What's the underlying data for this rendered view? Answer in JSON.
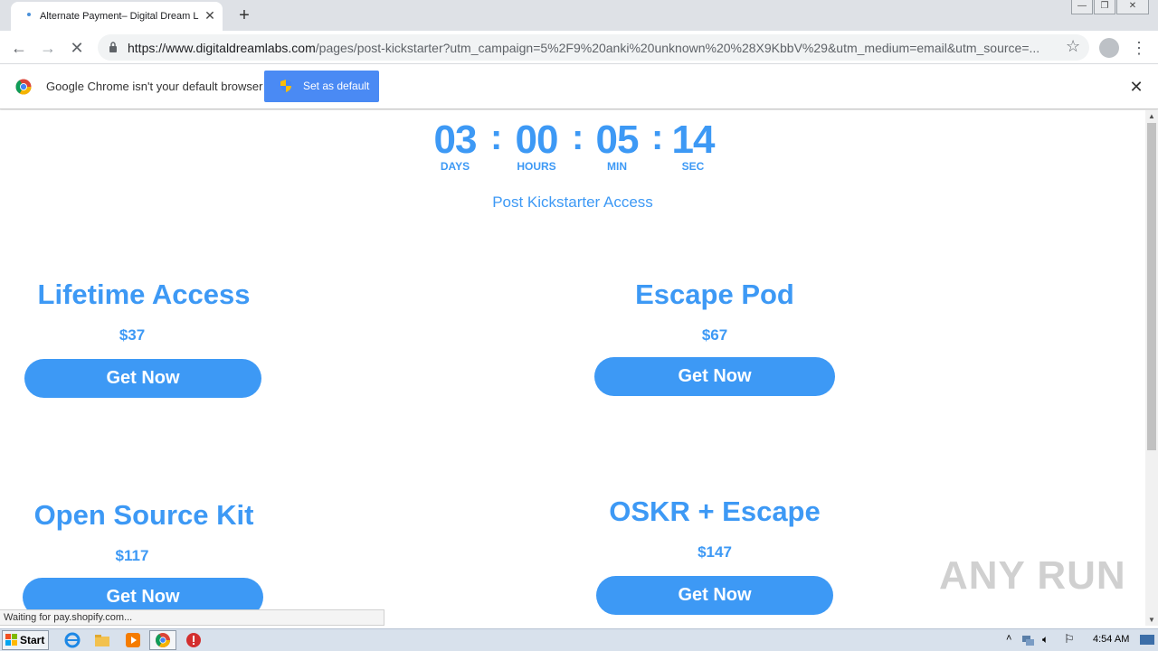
{
  "browser": {
    "tab_title": "Alternate Payment– Digital Dream La",
    "tab_close": "✕",
    "new_tab": "+",
    "window_controls": [
      "—",
      "❐",
      "✕"
    ],
    "url_host": "https://www.digitaldreamlabs.com",
    "url_rest": "/pages/post-kickstarter?utm_campaign=5%2F9%20anki%20unknown%20%28X9KbbV%29&utm_medium=email&utm_source=...",
    "icons": [
      "back-icon",
      "forward-icon",
      "stop-icon",
      "lock-icon",
      "star-icon",
      "profile-icon",
      "menu-icon"
    ]
  },
  "infobar": {
    "message": "Google Chrome isn't your default browser",
    "button": "Set as default",
    "close": "✕"
  },
  "countdown": {
    "days": "03",
    "hours": "00",
    "min": "05",
    "sec": "14",
    "separator": ":",
    "labels": {
      "days": "DAYS",
      "hours": "HOURS",
      "min": "MIN",
      "sec": "SEC"
    }
  },
  "subtitle": "Post Kickstarter Access",
  "products": [
    {
      "title": "Lifetime Access",
      "price": "$37",
      "button": "Get Now"
    },
    {
      "title": "Escape Pod",
      "price": "$67",
      "button": "Get Now"
    },
    {
      "title": "Open Source Kit",
      "price": "$117",
      "button": "Get Now"
    },
    {
      "title": "OSKR + Escape",
      "price": "$147",
      "button": "Get Now"
    }
  ],
  "status_text": "Waiting for pay.shopify.com...",
  "watermark": "ANY RUN",
  "taskbar": {
    "start": "Start",
    "clock": "4:54 AM"
  },
  "colors": {
    "accent": "#3d99f5",
    "chrome_button": "#4a8af4",
    "tab_strip": "#dee1e6"
  }
}
